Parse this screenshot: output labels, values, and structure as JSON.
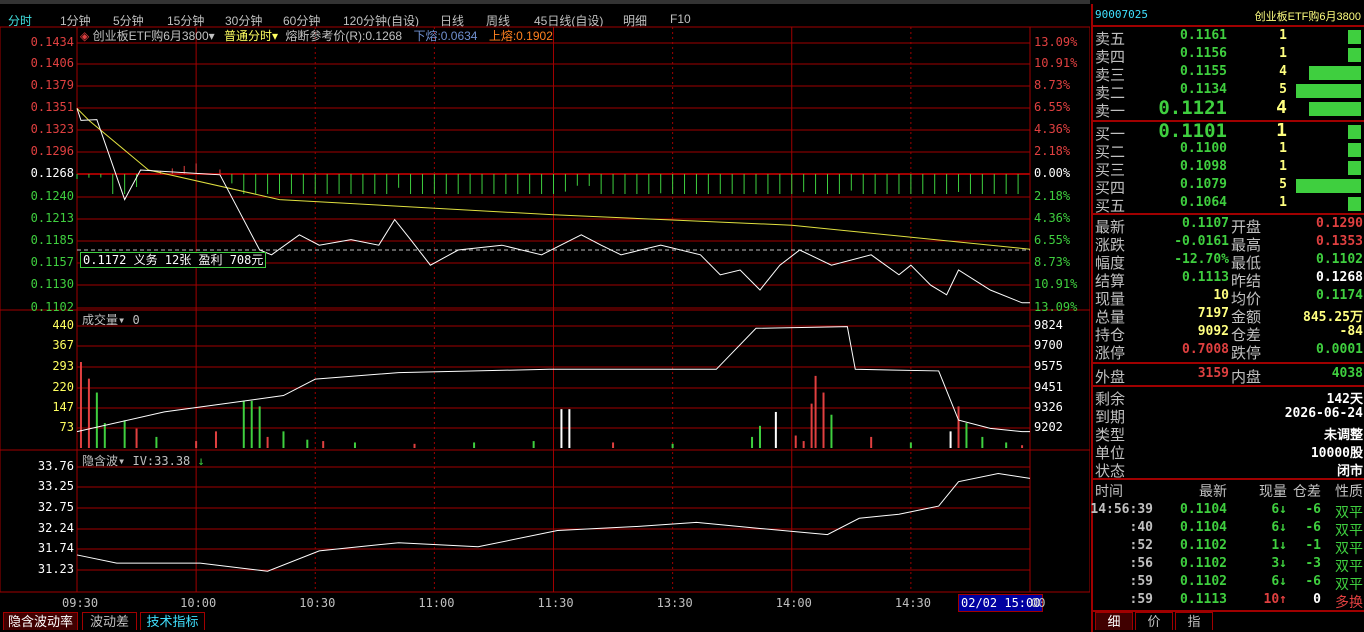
{
  "toolbar": {
    "tabs": [
      "分时",
      "1分钟",
      "5分钟",
      "15分钟",
      "30分钟",
      "60分钟",
      "120分钟(自设)",
      "日线",
      "周线",
      "45日线(自设)",
      "明细",
      "F10"
    ],
    "active": 0
  },
  "header": {
    "instrument": "创业板ETF购6月3800",
    "mode": "普通分时",
    "ref_price": "熔断参考价(R):0.1268",
    "lower": "下熔:0.0634",
    "upper": "上熔:0.1902"
  },
  "price_axis": {
    "left": [
      "0.1434",
      "0.1406",
      "0.1379",
      "0.1351",
      "0.1323",
      "0.1296",
      "0.1268",
      "0.1240",
      "0.1213",
      "0.1185",
      "0.1157",
      "0.1130",
      "0.1102"
    ],
    "right": [
      "13.09%",
      "10.91%",
      "8.73%",
      "6.55%",
      "4.36%",
      "2.18%",
      "0.00%",
      "2.18%",
      "4.36%",
      "6.55%",
      "8.73%",
      "10.91%",
      "13.09%"
    ]
  },
  "position_box": "0.1172 义务  12张  盈利  708元",
  "volume_panel": {
    "title": "成交量",
    "value": "0",
    "left": [
      "440",
      "367",
      "293",
      "220",
      "147",
      "73"
    ],
    "right": [
      "9824",
      "9700",
      "9575",
      "9451",
      "9326",
      "9202"
    ]
  },
  "iv_panel": {
    "title": "隐含波",
    "value": "IV:33.38",
    "arrow": "↓",
    "left": [
      "33.76",
      "33.25",
      "32.75",
      "32.24",
      "31.74",
      "31.23"
    ]
  },
  "time_axis": [
    "09:30",
    "10:00",
    "10:30",
    "11:00",
    "11:30",
    "13:30",
    "14:00",
    "14:30"
  ],
  "cursor_time": "02/02 15:00",
  "time_end_tail": "00",
  "bottom_tabs": [
    "隐含波动率",
    "波动差",
    "技术指标"
  ],
  "chart_data": {
    "type": "line",
    "x_unit": "trading minute from 09:30",
    "prev_settle": 0.1268,
    "price": [
      [
        0,
        0.135
      ],
      [
        1,
        0.1335
      ],
      [
        5,
        0.1336
      ],
      [
        12,
        0.1236
      ],
      [
        16,
        0.1273
      ],
      [
        36,
        0.1267
      ],
      [
        46,
        0.1173
      ],
      [
        49,
        0.1167
      ],
      [
        56,
        0.1192
      ],
      [
        61,
        0.1179
      ],
      [
        69,
        0.1186
      ],
      [
        76,
        0.1179
      ],
      [
        80,
        0.1211
      ],
      [
        84,
        0.1186
      ],
      [
        89,
        0.1154
      ],
      [
        96,
        0.1173
      ],
      [
        107,
        0.1179
      ],
      [
        117,
        0.1167
      ],
      [
        127,
        0.1192
      ],
      [
        132,
        0.1179
      ],
      [
        137,
        0.1167
      ],
      [
        147,
        0.1179
      ],
      [
        157,
        0.1167
      ],
      [
        162,
        0.1142
      ],
      [
        167,
        0.1148
      ],
      [
        172,
        0.1123
      ],
      [
        177,
        0.1154
      ],
      [
        182,
        0.1173
      ],
      [
        190,
        0.1154
      ],
      [
        200,
        0.1167
      ],
      [
        207,
        0.1142
      ],
      [
        210,
        0.1154
      ],
      [
        215,
        0.1129
      ],
      [
        219,
        0.1117
      ],
      [
        222,
        0.1148
      ],
      [
        230,
        0.1123
      ],
      [
        238,
        0.1107
      ],
      [
        240,
        0.1107
      ]
    ],
    "average": [
      [
        0,
        0.135
      ],
      [
        3,
        0.1335
      ],
      [
        18,
        0.1273
      ],
      [
        51,
        0.1236
      ],
      [
        120,
        0.1217
      ],
      [
        180,
        0.1204
      ],
      [
        240,
        0.1174
      ]
    ],
    "volume": [
      [
        1,
        310,
        "r"
      ],
      [
        3,
        250,
        "r"
      ],
      [
        5,
        200,
        "g"
      ],
      [
        7,
        90,
        "g"
      ],
      [
        12,
        100,
        "g"
      ],
      [
        15,
        70,
        "r"
      ],
      [
        20,
        40,
        "g"
      ],
      [
        30,
        25,
        "r"
      ],
      [
        35,
        60,
        "r"
      ],
      [
        42,
        170,
        "g"
      ],
      [
        44,
        170,
        "g"
      ],
      [
        46,
        150,
        "g"
      ],
      [
        48,
        40,
        "r"
      ],
      [
        52,
        60,
        "g"
      ],
      [
        58,
        30,
        "g"
      ],
      [
        62,
        25,
        "r"
      ],
      [
        70,
        20,
        "g"
      ],
      [
        85,
        15,
        "r"
      ],
      [
        100,
        20,
        "g"
      ],
      [
        115,
        25,
        "g"
      ],
      [
        122,
        140,
        "w"
      ],
      [
        124,
        140,
        "w"
      ],
      [
        135,
        20,
        "r"
      ],
      [
        150,
        15,
        "g"
      ],
      [
        170,
        40,
        "g"
      ],
      [
        172,
        80,
        "g"
      ],
      [
        176,
        130,
        "w"
      ],
      [
        181,
        45,
        "r"
      ],
      [
        183,
        25,
        "r"
      ],
      [
        185,
        160,
        "r"
      ],
      [
        186,
        260,
        "r"
      ],
      [
        188,
        200,
        "r"
      ],
      [
        190,
        120,
        "g"
      ],
      [
        200,
        40,
        "r"
      ],
      [
        210,
        20,
        "g"
      ],
      [
        220,
        60,
        "w"
      ],
      [
        222,
        150,
        "r"
      ],
      [
        224,
        90,
        "g"
      ],
      [
        228,
        40,
        "g"
      ],
      [
        234,
        20,
        "g"
      ],
      [
        238,
        10,
        "r"
      ]
    ],
    "open_interest": [
      [
        0,
        9180
      ],
      [
        22,
        9300
      ],
      [
        52,
        9400
      ],
      [
        60,
        9500
      ],
      [
        81,
        9540
      ],
      [
        119,
        9560
      ],
      [
        161,
        9560
      ],
      [
        171,
        9810
      ],
      [
        194,
        9820
      ],
      [
        196,
        9560
      ],
      [
        217,
        9550
      ],
      [
        222,
        9250
      ],
      [
        230,
        9200
      ],
      [
        238,
        9180
      ],
      [
        240,
        9180
      ]
    ],
    "iv": [
      [
        0,
        31.6
      ],
      [
        10,
        31.4
      ],
      [
        31,
        31.4
      ],
      [
        48,
        31.2
      ],
      [
        61,
        31.7
      ],
      [
        81,
        31.9
      ],
      [
        101,
        31.8
      ],
      [
        121,
        32.2
      ],
      [
        141,
        32.3
      ],
      [
        156,
        32.4
      ],
      [
        172,
        32.25
      ],
      [
        189,
        32.1
      ],
      [
        197,
        32.5
      ],
      [
        207,
        32.6
      ],
      [
        217,
        32.8
      ],
      [
        222,
        33.4
      ],
      [
        232,
        33.6
      ],
      [
        240,
        33.48
      ]
    ]
  },
  "quote": {
    "code": "90007025",
    "name": "创业板ETF购6月3800",
    "asks": [
      {
        "label": "卖五",
        "price": "0.1161",
        "qty": "1",
        "frac": 0.2
      },
      {
        "label": "卖四",
        "price": "0.1156",
        "qty": "1",
        "frac": 0.2
      },
      {
        "label": "卖三",
        "price": "0.1155",
        "qty": "4",
        "frac": 0.8
      },
      {
        "label": "卖二",
        "price": "0.1134",
        "qty": "5",
        "frac": 1.0
      },
      {
        "label": "卖一",
        "price": "0.1121",
        "qty": "4",
        "frac": 0.8
      }
    ],
    "bids": [
      {
        "label": "买一",
        "price": "0.1101",
        "qty": "1",
        "frac": 0.2
      },
      {
        "label": "买二",
        "price": "0.1100",
        "qty": "1",
        "frac": 0.2
      },
      {
        "label": "买三",
        "price": "0.1098",
        "qty": "1",
        "frac": 0.2
      },
      {
        "label": "买四",
        "price": "0.1079",
        "qty": "5",
        "frac": 1.0
      },
      {
        "label": "买五",
        "price": "0.1064",
        "qty": "1",
        "frac": 0.2
      }
    ],
    "stats": [
      {
        "l1": "最新",
        "v1": "0.1107",
        "c1": "g",
        "l2": "开盘",
        "v2": "0.1290",
        "c2": "r"
      },
      {
        "l1": "涨跌",
        "v1": "-0.0161",
        "c1": "g",
        "l2": "最高",
        "v2": "0.1353",
        "c2": "r"
      },
      {
        "l1": "幅度",
        "v1": "-12.70%",
        "c1": "g",
        "l2": "最低",
        "v2": "0.1102",
        "c2": "g"
      },
      {
        "l1": "结算",
        "v1": "0.1113",
        "c1": "g",
        "l2": "昨结",
        "v2": "0.1268",
        "c2": "w"
      },
      {
        "l1": "现量",
        "v1": "10",
        "c1": "y",
        "l2": "均价",
        "v2": "0.1174",
        "c2": "g"
      },
      {
        "l1": "总量",
        "v1": "7197",
        "c1": "y",
        "l2": "金额",
        "v2": "845.25万",
        "c2": "y"
      },
      {
        "l1": "持仓",
        "v1": "9092",
        "c1": "y",
        "l2": "仓差",
        "v2": "-84",
        "c2": "y"
      },
      {
        "l1": "涨停",
        "v1": "0.7008",
        "c1": "r",
        "l2": "跌停",
        "v2": "0.0001",
        "c2": "g"
      }
    ],
    "outer": {
      "l1": "外盘",
      "v1": "3159",
      "l2": "内盘",
      "v2": "4038"
    },
    "info": [
      {
        "l": "剩余",
        "v": "142天"
      },
      {
        "l": "到期",
        "v": "2026-06-24"
      },
      {
        "l": "类型",
        "v": "未调整"
      },
      {
        "l": "单位",
        "v": "10000股"
      },
      {
        "l": "状态",
        "v": "闭市"
      }
    ],
    "ticks_header": [
      "时间",
      "最新",
      "现量",
      "仓差",
      "性质"
    ],
    "ticks": [
      {
        "t": "14:56:39",
        "p": "0.1104",
        "q": "6",
        "d": "↓",
        "oi": "-6",
        "n": "双平",
        "c": "g"
      },
      {
        "t": ":40",
        "p": "0.1104",
        "q": "6",
        "d": "↓",
        "oi": "-6",
        "n": "双平",
        "c": "g"
      },
      {
        "t": ":52",
        "p": "0.1102",
        "q": "1",
        "d": "↓",
        "oi": "-1",
        "n": "双平",
        "c": "g"
      },
      {
        "t": ":56",
        "p": "0.1102",
        "q": "3",
        "d": "↓",
        "oi": "-3",
        "n": "双平",
        "c": "g"
      },
      {
        "t": ":59",
        "p": "0.1102",
        "q": "6",
        "d": "↓",
        "oi": "-6",
        "n": "双平",
        "c": "g"
      },
      {
        "t": ":59",
        "p": "0.1113",
        "q": "10",
        "d": "↑",
        "oi": "0",
        "n": "多换",
        "c": "r"
      }
    ],
    "tabs": [
      "细",
      "价",
      "指"
    ]
  }
}
